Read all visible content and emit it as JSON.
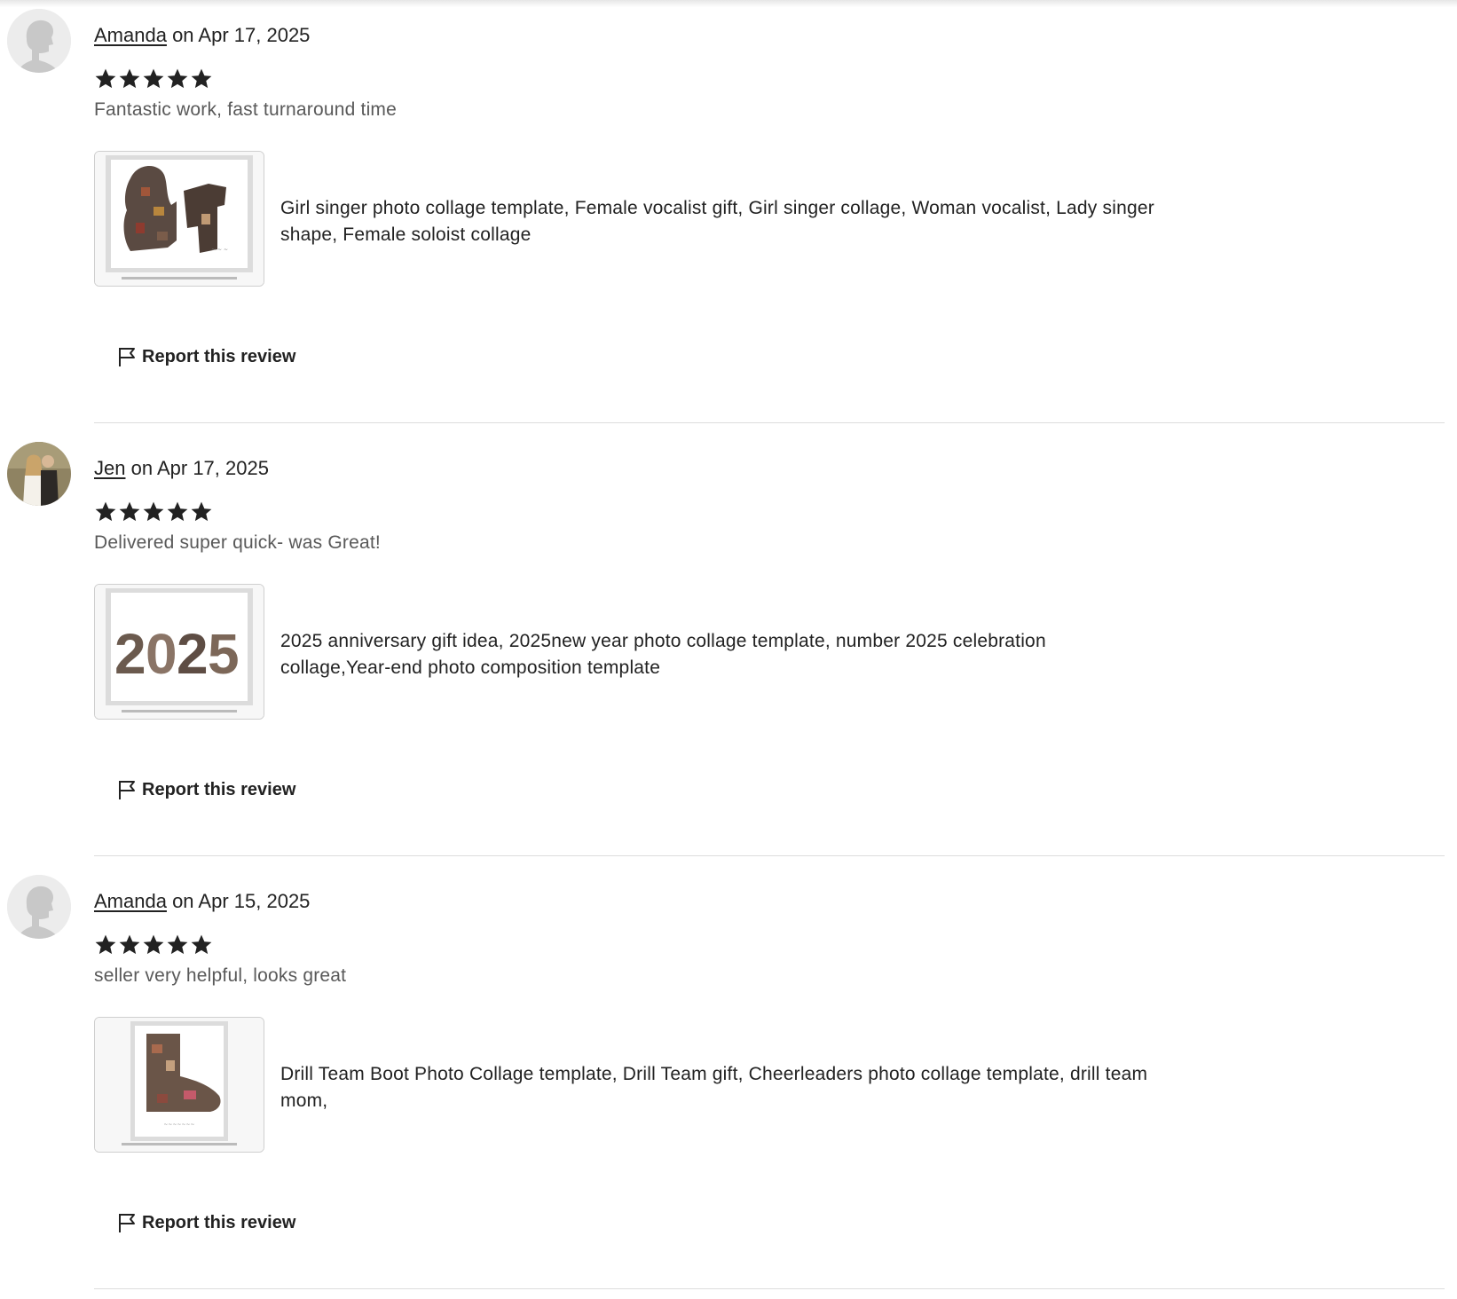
{
  "reviews": [
    {
      "reviewer": "Amanda",
      "date_text": " on Apr 17, 2025",
      "rating": 5,
      "text": "Fantastic work, fast turnaround time",
      "listing_title": "Girl singer photo collage template, Female vocalist gift, Girl singer collage, Woman vocalist, Lady singer shape, Female soloist collage",
      "avatar": "default-silhouette",
      "thumbnail": "singer-collage",
      "report_label": "Report this review"
    },
    {
      "reviewer": "Jen",
      "date_text": " on Apr 17, 2025",
      "rating": 5,
      "text": "Delivered super quick- was Great!",
      "listing_title": "2025 anniversary gift idea, 2025new year photo collage template, number 2025 celebration collage,Year-end photo composition template",
      "avatar": "couple-photo",
      "thumbnail": "2025-collage",
      "report_label": "Report this review"
    },
    {
      "reviewer": "Amanda",
      "date_text": " on Apr 15, 2025",
      "rating": 5,
      "text": "seller very helpful, looks great",
      "listing_title": "Drill Team Boot Photo Collage template, Drill Team gift, Cheerleaders photo collage template, drill team mom,",
      "avatar": "default-silhouette",
      "thumbnail": "boot-collage",
      "report_label": "Report this review"
    }
  ],
  "icons": {
    "star": "star-icon",
    "flag": "flag-icon"
  },
  "colors": {
    "text": "#222222",
    "muted_text": "#595959",
    "divider": "#dcdcdc",
    "star": "#222222"
  }
}
